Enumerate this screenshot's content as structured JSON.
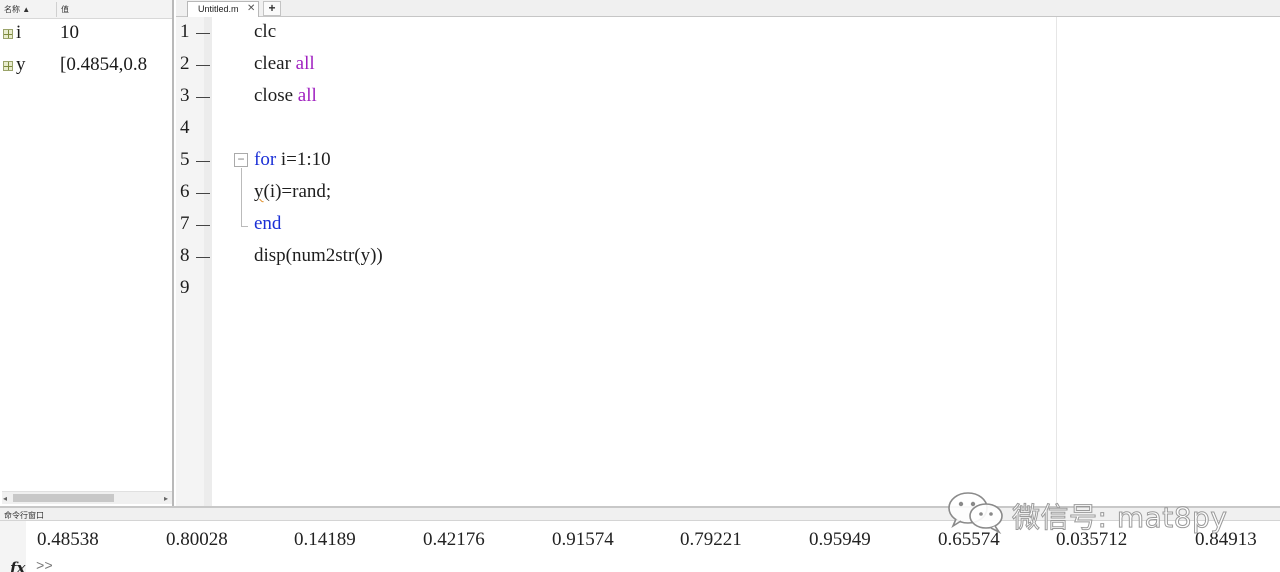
{
  "workspace": {
    "header": {
      "name": "名称 ▲",
      "value": "值"
    },
    "variables": [
      {
        "name": "i",
        "value": "10"
      },
      {
        "name": "y",
        "value": "[0.4854,0.8"
      }
    ],
    "scroll": {
      "left": "◂",
      "right": "▸"
    }
  },
  "editor": {
    "tab": {
      "label": "Untitled.m",
      "close": "✕"
    },
    "add_tab": "+",
    "fold_marker": "−",
    "lines": [
      {
        "n": "1",
        "code": "clc"
      },
      {
        "n": "2",
        "kw": "clear",
        "arg": "all"
      },
      {
        "n": "3",
        "kw": "close",
        "arg": "all"
      },
      {
        "n": "4"
      },
      {
        "n": "5",
        "kw": "for",
        "code": " i=1:10"
      },
      {
        "n": "6",
        "var": "y",
        "code": "(i)=rand;"
      },
      {
        "n": "7",
        "kw": "end"
      },
      {
        "n": "8",
        "code": "disp(num2str(y))"
      },
      {
        "n": "9"
      }
    ]
  },
  "command_window": {
    "title": "命令行窗口",
    "output": [
      "0.48538",
      "0.80028",
      "0.14189",
      "0.42176",
      "0.91574",
      "0.79221",
      "0.95949",
      "0.65574",
      "0.035712",
      "0.84913"
    ],
    "prompt": ">>",
    "fx": "fx"
  },
  "watermark": {
    "text": "微信号: mat8py"
  },
  "colors": {
    "keyword": "#1a2fd6",
    "string": "#a020c0",
    "warning_underline": "#e08a1e"
  }
}
